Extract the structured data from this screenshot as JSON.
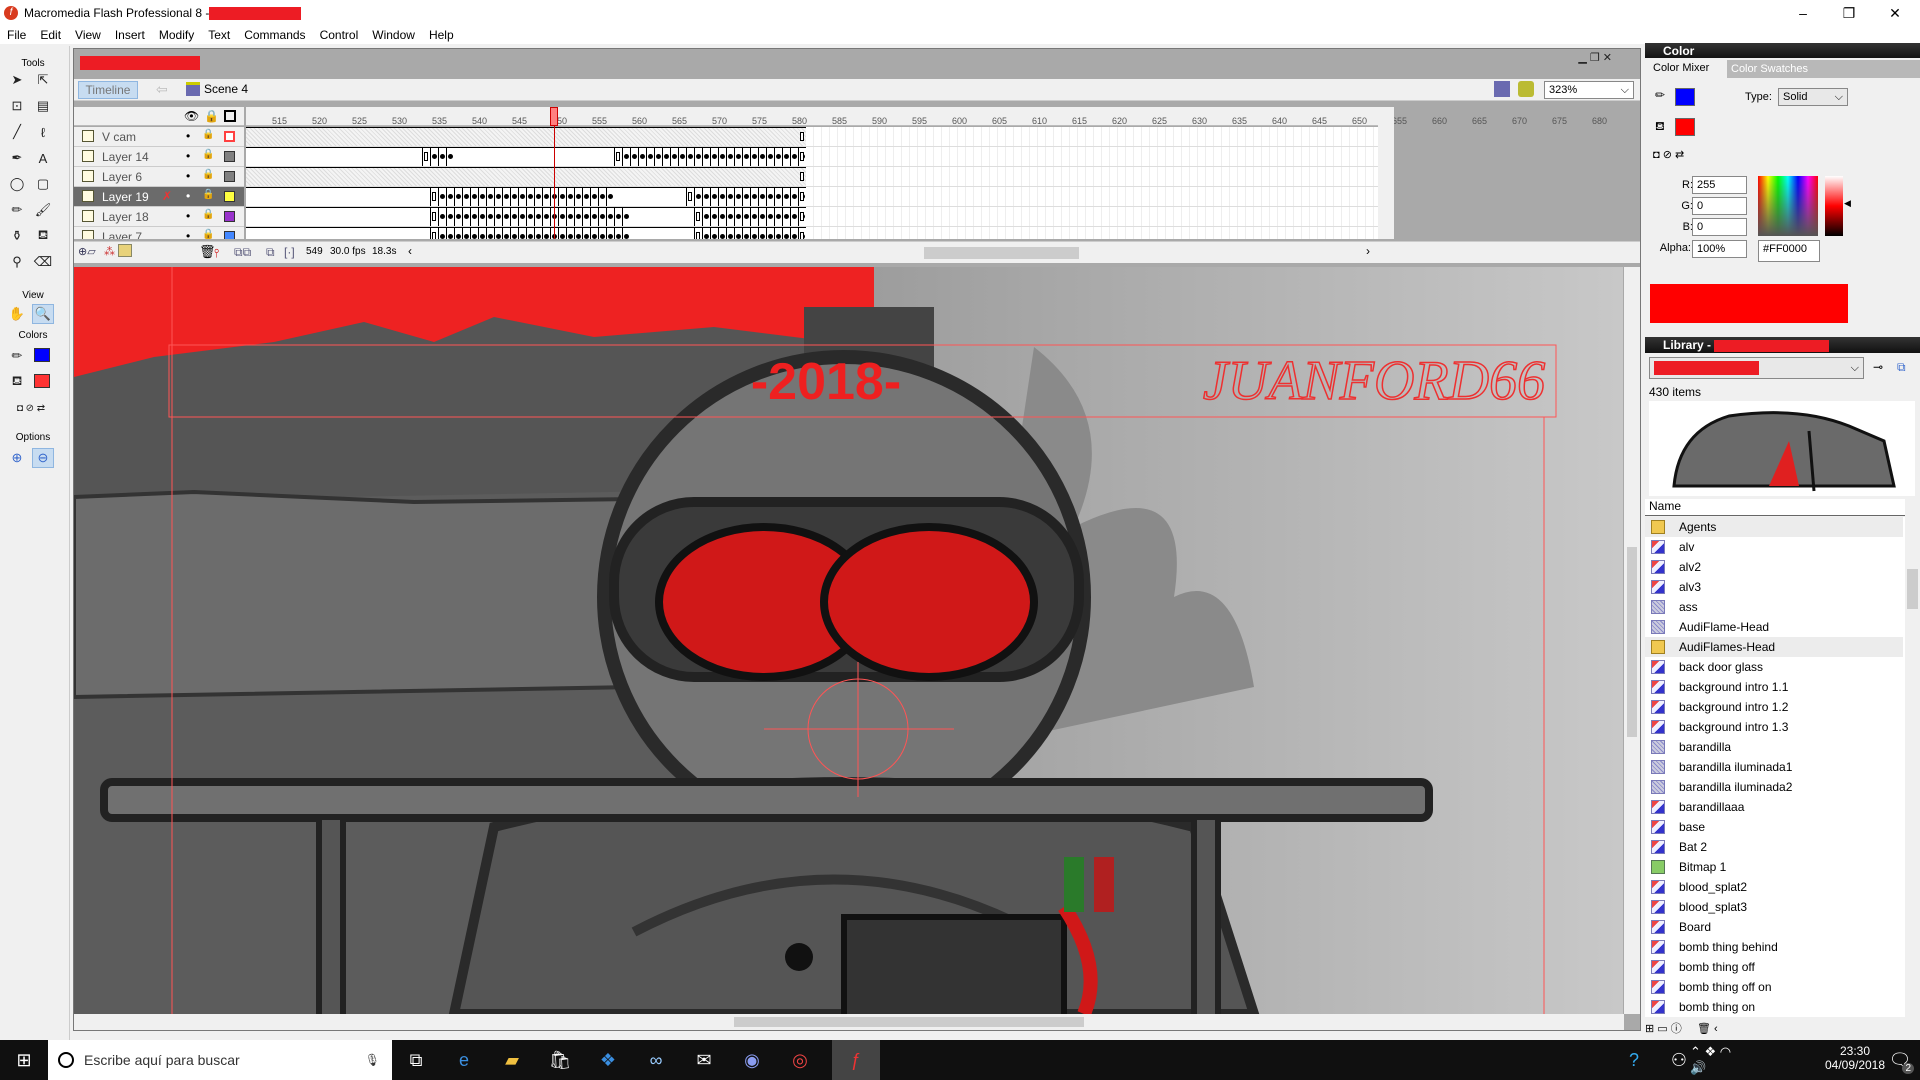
{
  "app": {
    "title": "Macromedia Flash Professional 8 - ",
    "min": "‒",
    "max": "❐",
    "close": "✕"
  },
  "menu": [
    "File",
    "Edit",
    "View",
    "Insert",
    "Modify",
    "Text",
    "Commands",
    "Control",
    "Window",
    "Help"
  ],
  "tools": {
    "label": "Tools",
    "view_label": "View",
    "colors_label": "Colors",
    "options_label": "Options",
    "items": [
      {
        "name": "arrow-tool-icon",
        "g": "➤"
      },
      {
        "name": "subselect-tool-icon",
        "g": "⇱"
      },
      {
        "name": "free-transform-icon",
        "g": "⊡"
      },
      {
        "name": "gradient-transform-icon",
        "g": "▤"
      },
      {
        "name": "line-tool-icon",
        "g": "╱"
      },
      {
        "name": "lasso-tool-icon",
        "g": "ℓ"
      },
      {
        "name": "pen-tool-icon",
        "g": "✒"
      },
      {
        "name": "text-tool-icon",
        "g": "A"
      },
      {
        "name": "oval-tool-icon",
        "g": "◯"
      },
      {
        "name": "rectangle-tool-icon",
        "g": "▢"
      },
      {
        "name": "pencil-tool-icon",
        "g": "✏"
      },
      {
        "name": "brush-tool-icon",
        "g": "🖌"
      },
      {
        "name": "ink-bottle-icon",
        "g": "⚱"
      },
      {
        "name": "paint-bucket-icon",
        "g": "⛾"
      },
      {
        "name": "eyedropper-icon",
        "g": "⚲"
      },
      {
        "name": "eraser-icon",
        "g": "⌫"
      }
    ]
  },
  "document": {
    "timeline_label": "Timeline",
    "scene": "Scene 4",
    "zoom": "323%"
  },
  "timeline": {
    "ruler_ticks": [
      515,
      520,
      525,
      530,
      535,
      540,
      545,
      550,
      555,
      560,
      565,
      570,
      575,
      580,
      585,
      590,
      595,
      600,
      605,
      610,
      615,
      620,
      625,
      630,
      635,
      640,
      645,
      650,
      655,
      660,
      665,
      670,
      675,
      680
    ],
    "first_frame": 511,
    "current_frame": 549,
    "layers": [
      {
        "name": "V cam",
        "color": "#ff4040",
        "outline": true,
        "spans": []
      },
      {
        "name": "Layer 14",
        "color": "#808080",
        "spans": [
          [
            533,
            536
          ],
          [
            557,
            580
          ]
        ]
      },
      {
        "name": "Layer 6",
        "color": "#808080",
        "spans": []
      },
      {
        "name": "Layer 19",
        "color": "#ffff40",
        "selected": true,
        "spans": [
          [
            534,
            556
          ],
          [
            566,
            580
          ]
        ]
      },
      {
        "name": "Layer 18",
        "color": "#9933cc",
        "spans": [
          [
            534,
            558
          ],
          [
            567,
            580
          ]
        ]
      },
      {
        "name": "Layer 7",
        "color": "#4488ff",
        "spans": [
          [
            534,
            558
          ],
          [
            567,
            580
          ]
        ]
      }
    ],
    "footer": {
      "frame": "549",
      "fps": "30.0 fps",
      "time": "18.3s"
    }
  },
  "stage": {
    "year_text": "-2018-",
    "logo_text": "JUANFORD66"
  },
  "color_panel": {
    "title": "Color",
    "tab_mixer": "Color Mixer",
    "tab_swatches": "Color Swatches",
    "type_label": "Type:",
    "type_value": "Solid",
    "stroke_color": "#0000ff",
    "fill_color": "#ff0000",
    "r_label": "R:",
    "r": "255",
    "g_label": "G:",
    "g": "0",
    "b_label": "B:",
    "b": "0",
    "alpha_label": "Alpha:",
    "alpha": "100%",
    "hex": "#FF0000"
  },
  "library": {
    "title": "Library - ",
    "count": "430 items",
    "name_header": "Name",
    "items": [
      {
        "label": "Agents",
        "type": "folder"
      },
      {
        "label": "alv",
        "type": "movieclip"
      },
      {
        "label": "alv2",
        "type": "movieclip"
      },
      {
        "label": "alv3",
        "type": "movieclip"
      },
      {
        "label": "ass",
        "type": "graphic"
      },
      {
        "label": "AudiFlame-Head",
        "type": "graphic"
      },
      {
        "label": "AudiFlames-Head",
        "type": "folder"
      },
      {
        "label": "back door glass",
        "type": "movieclip"
      },
      {
        "label": "background intro 1.1",
        "type": "movieclip"
      },
      {
        "label": "background intro 1.2",
        "type": "movieclip"
      },
      {
        "label": "background intro 1.3",
        "type": "movieclip"
      },
      {
        "label": "barandilla",
        "type": "graphic"
      },
      {
        "label": "barandilla iluminada1",
        "type": "graphic"
      },
      {
        "label": "barandilla iluminada2",
        "type": "graphic"
      },
      {
        "label": "barandillaaa",
        "type": "movieclip"
      },
      {
        "label": "base",
        "type": "movieclip"
      },
      {
        "label": "Bat 2",
        "type": "movieclip"
      },
      {
        "label": "Bitmap 1",
        "type": "bitmap"
      },
      {
        "label": "blood_splat2",
        "type": "movieclip"
      },
      {
        "label": "blood_splat3",
        "type": "movieclip"
      },
      {
        "label": "Board",
        "type": "movieclip"
      },
      {
        "label": "bomb thing behind",
        "type": "movieclip"
      },
      {
        "label": "bomb thing off",
        "type": "movieclip"
      },
      {
        "label": "bomb thing off on",
        "type": "movieclip"
      },
      {
        "label": "bomb thing on",
        "type": "movieclip"
      }
    ]
  },
  "taskbar": {
    "search_placeholder": "Escribe aquí para buscar",
    "time": "23:30",
    "date": "04/09/2018",
    "notifications": "2"
  }
}
